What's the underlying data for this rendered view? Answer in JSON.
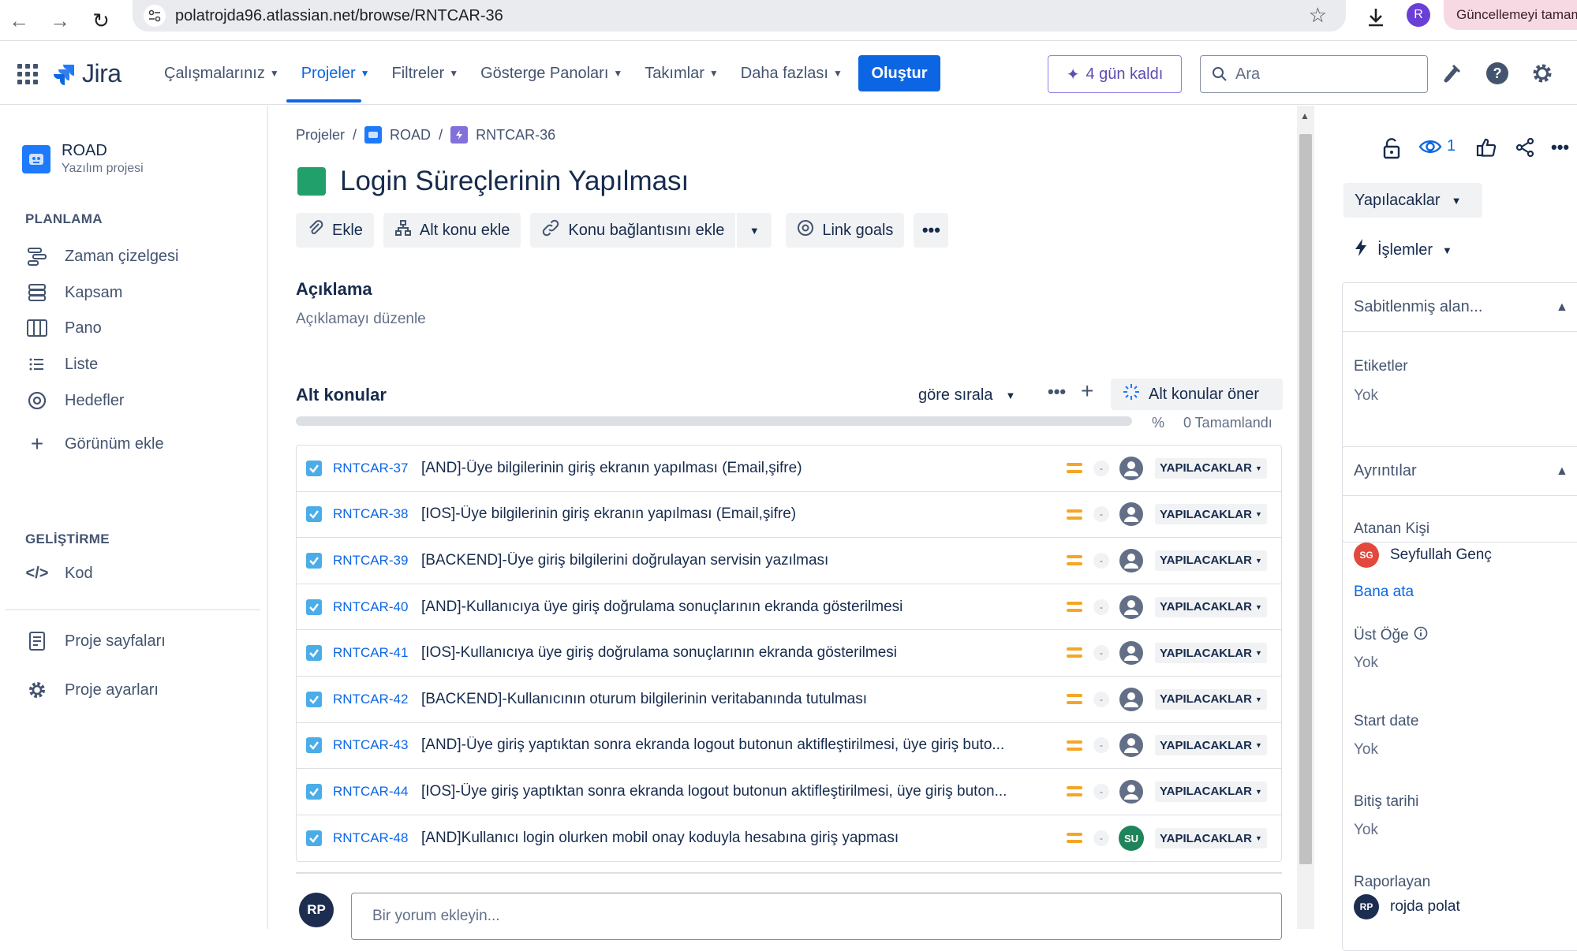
{
  "browser": {
    "url": "polatrojda96.atlassian.net/browse/RNTCAR-36",
    "profile_initial": "R",
    "update_label": "Güncellemeyi tamamla"
  },
  "topnav": {
    "logo": "Jira",
    "items": [
      "Çalışmalarınız",
      "Projeler",
      "Filtreler",
      "Gösterge Panoları",
      "Takımlar",
      "Daha fazlası"
    ],
    "create_label": "Oluştur",
    "trial_label": "4 gün kaldı",
    "search_placeholder": "Ara"
  },
  "sidebar": {
    "project_name": "ROAD",
    "project_type": "Yazılım projesi",
    "section_planning": "PLANLAMA",
    "planning_items": [
      "Zaman çizelgesi",
      "Kapsam",
      "Pano",
      "Liste",
      "Hedefler"
    ],
    "add_view": "Görünüm ekle",
    "section_dev": "GELİŞTİRME",
    "dev_items": [
      "Kod"
    ],
    "bottom_items": [
      "Proje sayfaları",
      "Proje ayarları"
    ]
  },
  "issue": {
    "breadcrumb": [
      "Projeler",
      "ROAD",
      "RNTCAR-36"
    ],
    "title": "Login Süreçlerinin Yapılması",
    "actions": {
      "attach": "Ekle",
      "add_subtask": "Alt konu ekle",
      "link_issue": "Konu bağlantısını ekle",
      "link_goals": "Link goals"
    },
    "description_title": "Açıklama",
    "description_edit": "Açıklamayı düzenle",
    "subtasks_title": "Alt konular",
    "sort_label": "göre sırala",
    "suggest_label": "Alt konular öner",
    "progress_percent_symbol": "%",
    "progress_done": "0 Tamamlandı",
    "progress_value": 0,
    "subtasks": [
      {
        "key": "RNTCAR-37",
        "summary": "[AND]-Üye bilgilerinin giriş ekranın yapılması (Email,şifre)",
        "dash": "-",
        "assignee": "",
        "status": "YAPILACAKLAR"
      },
      {
        "key": "RNTCAR-38",
        "summary": "[IOS]-Üye bilgilerinin giriş ekranın yapılması (Email,şifre)",
        "dash": "-",
        "assignee": "",
        "status": "YAPILACAKLAR"
      },
      {
        "key": "RNTCAR-39",
        "summary": "[BACKEND]-Üye giriş bilgilerini doğrulayan servisin yazılması",
        "dash": "-",
        "assignee": "",
        "status": "YAPILACAKLAR"
      },
      {
        "key": "RNTCAR-40",
        "summary": "[AND]-Kullanıcıya üye giriş doğrulama sonuçlarının ekranda gösterilmesi",
        "dash": "-",
        "assignee": "",
        "status": "YAPILACAKLAR"
      },
      {
        "key": "RNTCAR-41",
        "summary": "[IOS]-Kullanıcıya üye giriş doğrulama sonuçlarının ekranda gösterilmesi",
        "dash": "-",
        "assignee": "",
        "status": "YAPILACAKLAR"
      },
      {
        "key": "RNTCAR-42",
        "summary": "[BACKEND]-Kullanıcının oturum bilgilerinin veritabanında tutulması",
        "dash": "-",
        "assignee": "",
        "status": "YAPILACAKLAR"
      },
      {
        "key": "RNTCAR-43",
        "summary": "[AND]-Üye giriş yaptıktan sonra ekranda logout butonun aktifleştirilmesi, üye giriş buto...",
        "dash": "-",
        "assignee": "",
        "status": "YAPILACAKLAR"
      },
      {
        "key": "RNTCAR-44",
        "summary": "[IOS]-Üye giriş yaptıktan sonra ekranda logout butonun aktifleştirilmesi, üye giriş buton...",
        "dash": "-",
        "assignee": "",
        "status": "YAPILACAKLAR"
      },
      {
        "key": "RNTCAR-48",
        "summary": "[AND]Kullanıcı login olurken mobil onay koduyla hesabına giriş yapması",
        "dash": "-",
        "assignee": "SU",
        "status": "YAPILACAKLAR"
      }
    ],
    "comment_avatar": "RP",
    "comment_placeholder": "Bir yorum ekleyin..."
  },
  "panel": {
    "watch_count": "1",
    "status": "Yapılacaklar",
    "operations": "İşlemler",
    "pinned_title": "Sabitlenmiş alan...",
    "labels_label": "Etiketler",
    "labels_value": "Yok",
    "details_title": "Ayrıntılar",
    "assignee_label": "Atanan Kişi",
    "assignee_initials": "SG",
    "assignee_name": "Seyfullah Genç",
    "assign_me": "Bana ata",
    "parent_label": "Üst Öğe",
    "parent_value": "Yok",
    "start_label": "Start date",
    "start_value": "Yok",
    "due_label": "Bitiş tarihi",
    "due_value": "Yok",
    "reporter_label": "Raporlayan",
    "reporter_initials": "RP",
    "reporter_name": "rojda polat"
  },
  "colors": {
    "brand_blue": "#0c66e4",
    "issue_green": "#22a06b",
    "priority_medium": "#f5a623",
    "assignee_sg": "#e2483d"
  }
}
